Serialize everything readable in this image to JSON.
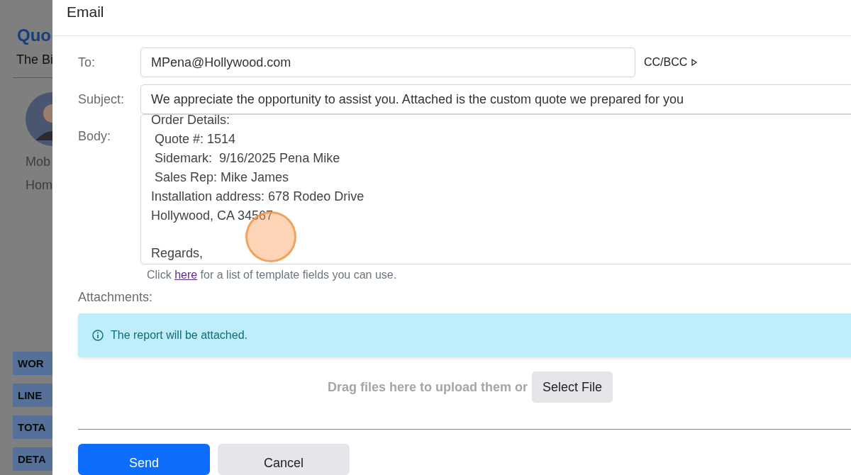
{
  "background_page": {
    "title": "Quo",
    "subtitle": "The Bi",
    "contacts": [
      "Mob",
      "Hom"
    ],
    "section_buttons": [
      "WOR",
      "LINE",
      "TOTA",
      "DETA"
    ]
  },
  "dialog": {
    "title": "Email",
    "to": {
      "label": "To:",
      "value": "MPena@Hollywood.com",
      "cc_bcc": "CC/BCC"
    },
    "subject": {
      "label": "Subject:",
      "value": "We appreciate the opportunity to assist you. Attached is the custom quote we prepared for you"
    },
    "body": {
      "label": "Body:",
      "paragraphs": [
        [
          "Order Details:",
          " Quote #: 1514",
          " Sidemark:  9/16/2025 Pena Mike",
          " Sales Rep: Mike James",
          "Installation address: 678 Rodeo Drive",
          "Hollywood, CA 34567"
        ],
        [
          "Regards,"
        ]
      ]
    },
    "help": {
      "before": "Click",
      "link": "here",
      "after": "for a list of template fields you can use."
    },
    "attachments": {
      "label": "Attachments:",
      "notice": "The report will be attached.",
      "drop_text": "Drag files here to upload them or",
      "select_button": "Select File"
    },
    "buttons": [
      {
        "label": "Send",
        "kind": "primary"
      },
      {
        "label": "Cancel",
        "kind": "secondary"
      }
    ]
  }
}
